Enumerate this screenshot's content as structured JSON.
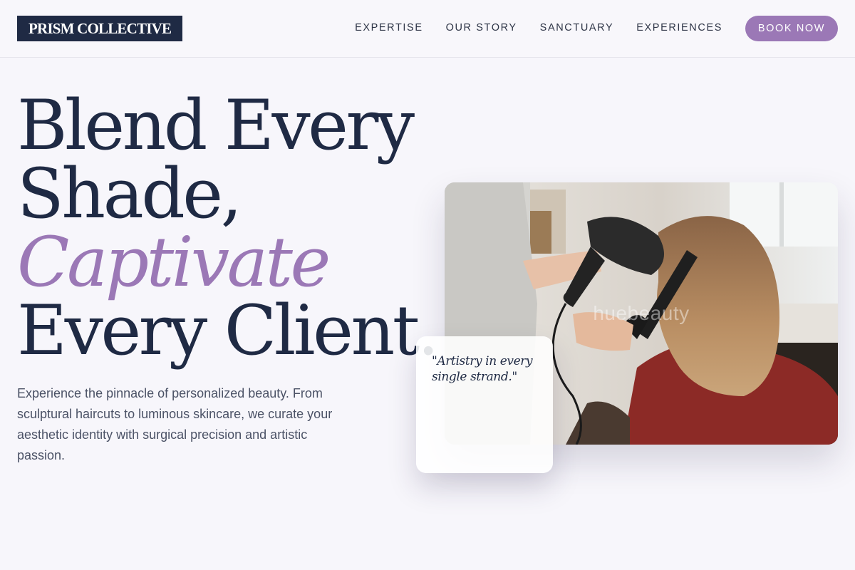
{
  "brand": {
    "logo_text": "PRISM COLLECTIVE"
  },
  "nav": {
    "items": [
      {
        "label": "EXPERTISE"
      },
      {
        "label": "OUR STORY"
      },
      {
        "label": "SANCTUARY"
      },
      {
        "label": "EXPERIENCES"
      }
    ],
    "cta_label": "BOOK NOW"
  },
  "hero": {
    "title_lines": [
      "Blend Every",
      "Shade,",
      "Captivate",
      "Every Client."
    ],
    "description": "Experience the pinnacle of personalized beauty. From sculptural haircuts to luminous skincare, we curate your aesthetic identity with surgical precision and artistic passion."
  },
  "photo": {
    "watermark": "huebeauty"
  },
  "quote": {
    "text": "\"Artistry in every single strand.\""
  },
  "colors": {
    "accent": "#9b78b6",
    "ink": "#1f2a44",
    "background": "#f7f6fb",
    "body_text": "#4b5266"
  }
}
